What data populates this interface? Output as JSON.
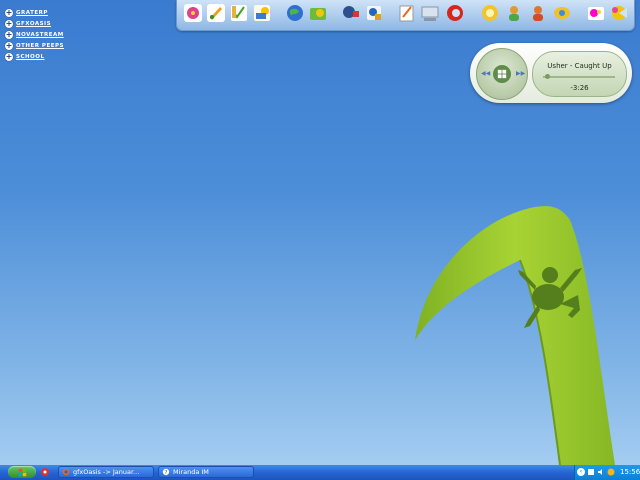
{
  "desktop": {
    "groups": [
      {
        "label": "GRATERP"
      },
      {
        "label": "GFXOASIS"
      },
      {
        "label": "NOVASTREAM"
      },
      {
        "label": "OTHER PEEPS"
      },
      {
        "label": "SCHOOL"
      }
    ]
  },
  "dock": {
    "icons": [
      "flower-icon",
      "paint-icon",
      "notepad-icon",
      "mail-icon",
      "globe-icon",
      "folder-icon",
      "satellite-icon",
      "tools-icon",
      "documents-icon",
      "computer-icon",
      "magnet-icon",
      "sun-icon",
      "user-icon",
      "people-icon",
      "chat-icon",
      "games-icon",
      "pacman-icon"
    ]
  },
  "player": {
    "track": "Usher - Caught Up",
    "time": "-3:26",
    "progress": 0.05
  },
  "taskbar": {
    "tasks": [
      {
        "label": "gfxOasis -> Januar...",
        "icon": "firefox-icon"
      },
      {
        "label": "Miranda IM",
        "icon": "miranda-icon"
      }
    ],
    "clock": "15:56"
  }
}
